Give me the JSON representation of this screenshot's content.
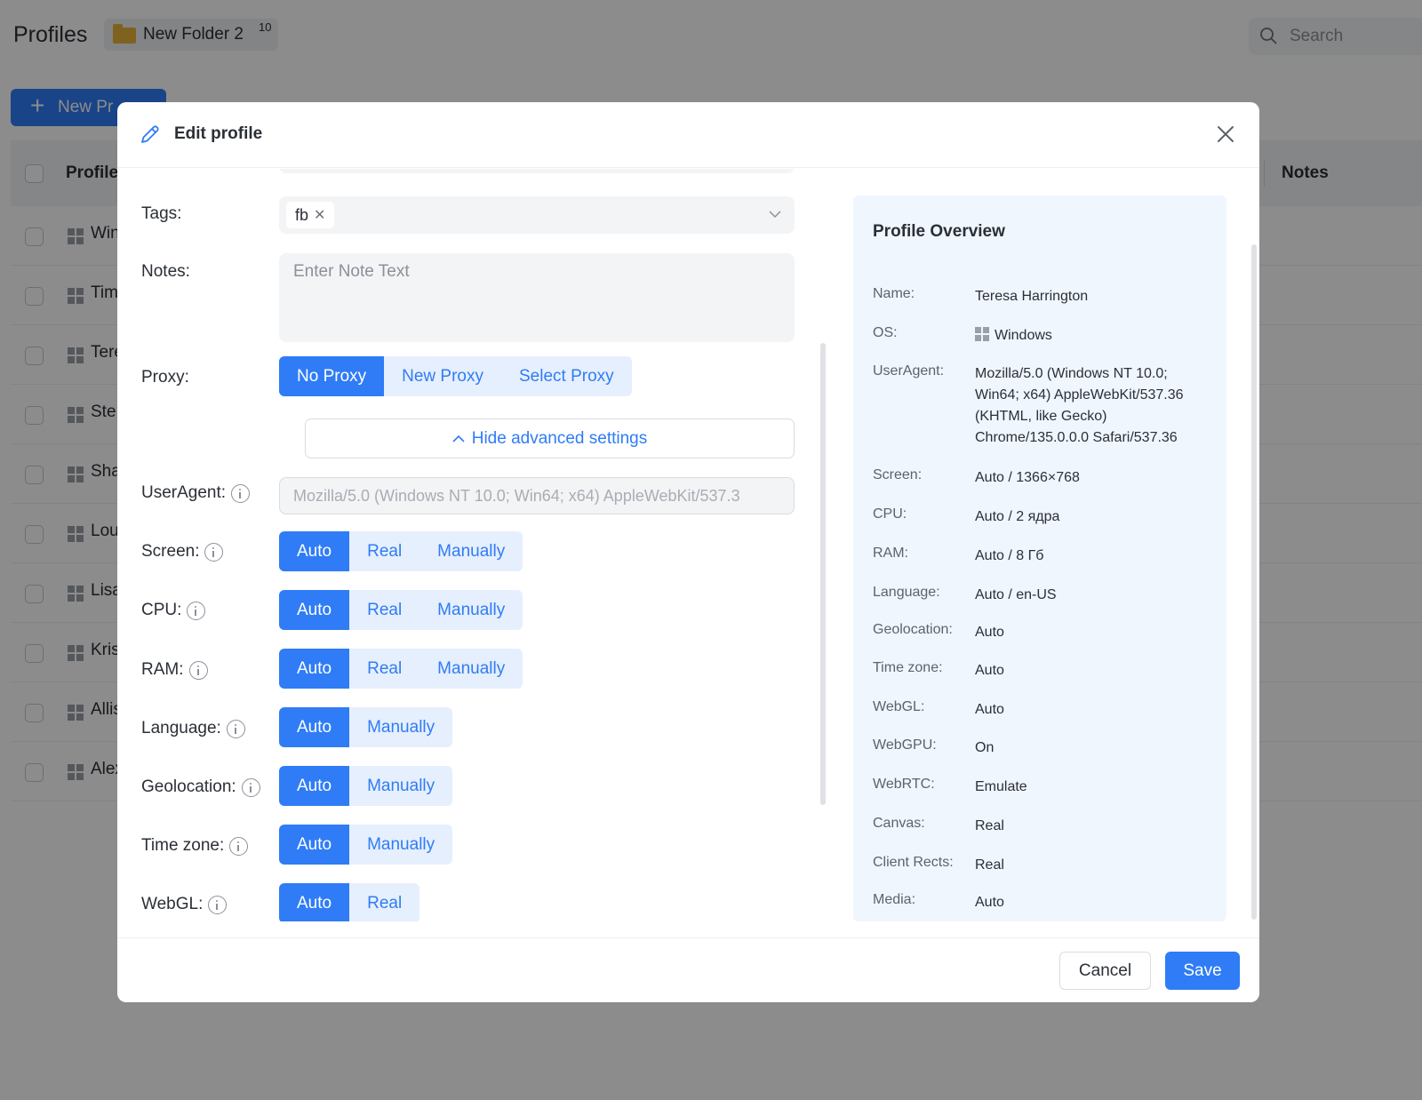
{
  "app": {
    "title": "Profiles",
    "folder": {
      "name": "New Folder 2",
      "count": "10"
    },
    "search_placeholder": "Search",
    "new_button": "New Pr",
    "table": {
      "col_profile": "Profile",
      "col_notes": "Notes",
      "rows": [
        "Win",
        "Tim",
        "Tere",
        "Ste",
        "Sha",
        "Lou",
        "Lisa",
        "Kris",
        "Allis",
        "Alex"
      ]
    }
  },
  "modal": {
    "title": "Edit profile",
    "labels": {
      "tags": "Tags:",
      "notes": "Notes:",
      "proxy": "Proxy:",
      "useragent": "UserAgent:",
      "screen": "Screen:",
      "cpu": "CPU:",
      "ram": "RAM:",
      "language": "Language:",
      "geolocation": "Geolocation:",
      "timezone": "Time zone:",
      "webgl": "WebGL:"
    },
    "tag_value": "fb",
    "notes_placeholder": "Enter Note Text",
    "proxy_options": [
      "No Proxy",
      "New Proxy",
      "Select Proxy"
    ],
    "advanced_toggle": "Hide advanced settings",
    "useragent_value": "Mozilla/5.0 (Windows NT 10.0; Win64; x64) AppleWebKit/537.3",
    "options": {
      "auto": "Auto",
      "real": "Real",
      "manually": "Manually"
    },
    "overview": {
      "title": "Profile Overview",
      "items": [
        {
          "key": "Name:",
          "value": "Teresa Harrington"
        },
        {
          "key": "OS:",
          "value": "Windows"
        },
        {
          "key": "UserAgent:",
          "value": "Mozilla/5.0 (Windows NT 10.0; Win64; x64) AppleWebKit/537.36 (KHTML, like Gecko) Chrome/135.0.0.0 Safari/537.36"
        },
        {
          "key": "Screen:",
          "value": "Auto / 1366×768"
        },
        {
          "key": "CPU:",
          "value": "Auto / 2 ядра"
        },
        {
          "key": "RAM:",
          "value": "Auto / 8 Гб"
        },
        {
          "key": "Language:",
          "value": "Auto / en-US"
        },
        {
          "key": "Geolocation:",
          "value": "Auto"
        },
        {
          "key": "Time zone:",
          "value": "Auto"
        },
        {
          "key": "WebGL:",
          "value": "Auto"
        },
        {
          "key": "WebGPU:",
          "value": "On"
        },
        {
          "key": "WebRTC:",
          "value": "Emulate"
        },
        {
          "key": "Canvas:",
          "value": "Real"
        },
        {
          "key": "Client Rects:",
          "value": "Real"
        },
        {
          "key": "Media:",
          "value": "Auto"
        }
      ]
    },
    "cancel": "Cancel",
    "save": "Save"
  },
  "colors": {
    "accent": "#2f7cf6",
    "accent_light": "#e6effd",
    "overview_bg": "#f0f6fe"
  }
}
